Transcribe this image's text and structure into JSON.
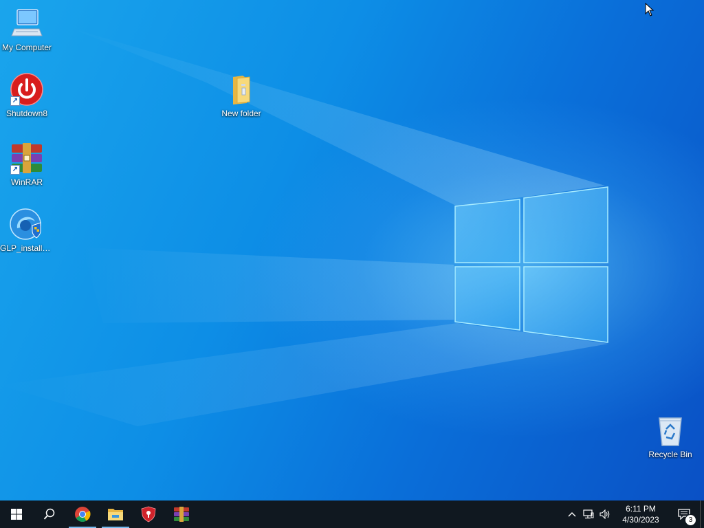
{
  "desktop": {
    "icons": [
      {
        "label": "My Computer",
        "icon": "computer-icon"
      },
      {
        "label": "Shutdown8",
        "icon": "power-icon"
      },
      {
        "label": "WinRAR",
        "icon": "winrar-icon"
      },
      {
        "label": "GLP_installe...",
        "icon": "installer-icon"
      },
      {
        "label": "New folder",
        "icon": "folder-icon"
      },
      {
        "label": "Recycle Bin",
        "icon": "recycle-bin-icon"
      }
    ]
  },
  "taskbar": {
    "pinned": [
      {
        "name": "Start",
        "icon": "windows-start-icon"
      },
      {
        "name": "Search",
        "icon": "search-icon"
      },
      {
        "name": "Google Chrome",
        "icon": "chrome-icon"
      },
      {
        "name": "File Explorer",
        "icon": "file-explorer-icon"
      },
      {
        "name": "Shield",
        "icon": "shield-icon"
      },
      {
        "name": "WinRAR",
        "icon": "winrar-icon"
      }
    ],
    "tray": {
      "icons": [
        "chevron-up-icon",
        "network-icon",
        "volume-icon"
      ],
      "time": "6:11 PM",
      "date": "4/30/2023",
      "notification_count": "3"
    }
  },
  "colors": {
    "taskbar": "#101820",
    "active_indicator": "#76b9ed",
    "desktop_accent": "#0a6fd9"
  }
}
